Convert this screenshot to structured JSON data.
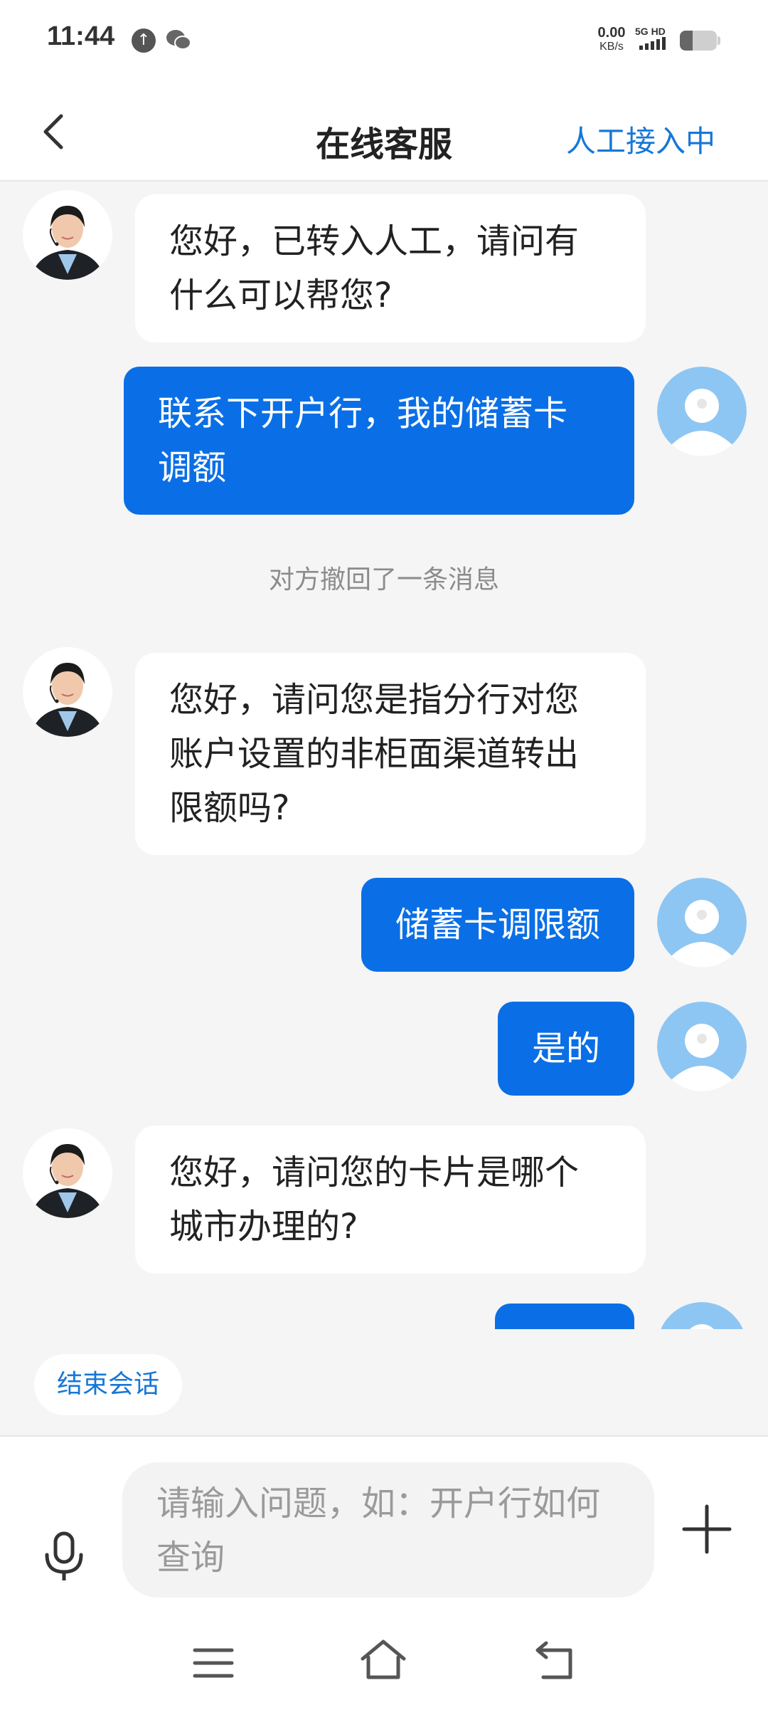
{
  "status_bar": {
    "time": "11:44",
    "net_speed_value": "0.00",
    "net_speed_unit": "KB/s",
    "signal_label": "5G HD",
    "battery_level": 0.35
  },
  "header": {
    "title": "在线客服",
    "status": "人工接入中"
  },
  "messages": [
    {
      "from": "agent",
      "text": "您好，已转入人工，请问有什么可以帮您?"
    },
    {
      "from": "user",
      "text": "联系下开户行，我的储蓄卡调额"
    },
    {
      "from": "system",
      "text": "对方撤回了一条消息"
    },
    {
      "from": "agent",
      "text": "您好，请问您是指分行对您账户设置的非柜面渠道转出限额吗?"
    },
    {
      "from": "user",
      "text": "储蓄卡调限额"
    },
    {
      "from": "user",
      "text": "是的"
    },
    {
      "from": "agent",
      "text": "您好，请问您的卡片是哪个城市办理的?"
    }
  ],
  "quick_actions": {
    "end_chat": "结束会话"
  },
  "input": {
    "placeholder": "请输入问题，如：开户行如何查询"
  },
  "colors": {
    "accent": "#1677d8",
    "user_bubble": "#0a6fe6",
    "background": "#f5f5f5"
  },
  "icons": {
    "back": "chevron-left-icon",
    "mic": "microphone-icon",
    "plus": "plus-icon",
    "nav_menu": "menu-icon",
    "nav_home": "home-icon",
    "nav_back": "back-icon"
  }
}
